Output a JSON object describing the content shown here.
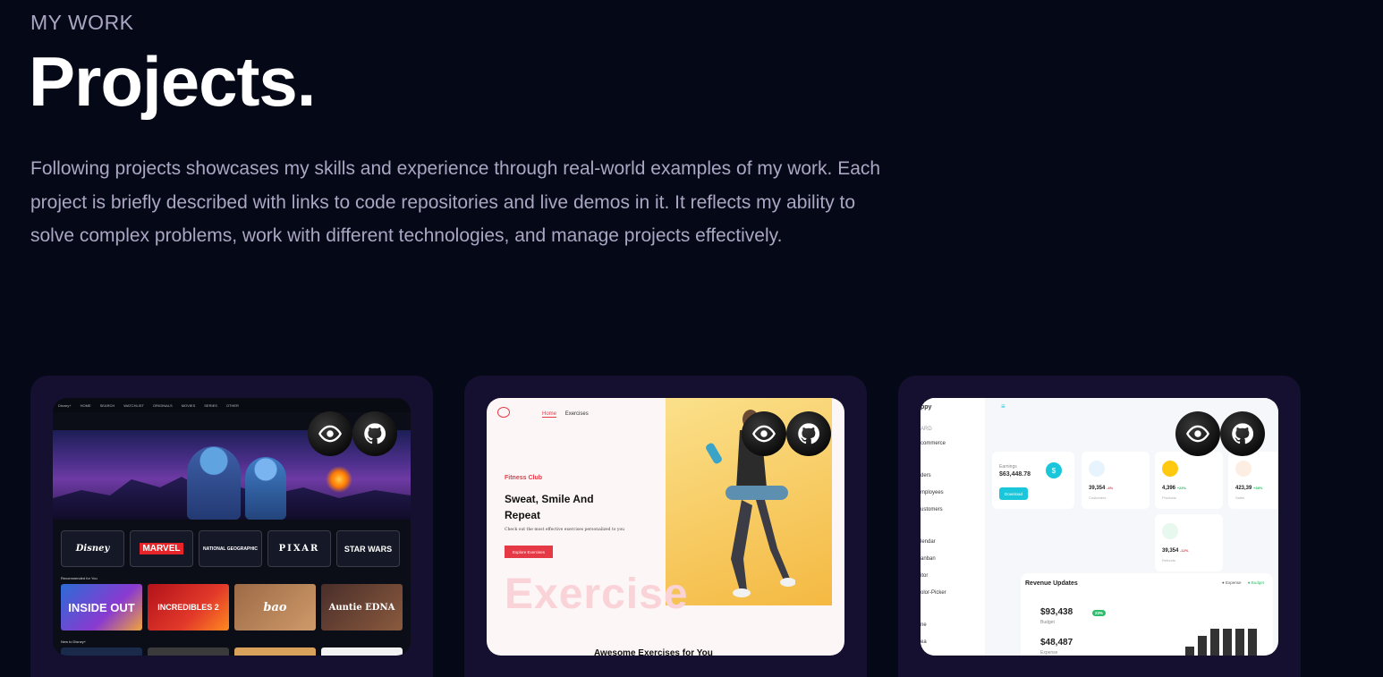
{
  "section": {
    "eyebrow": "MY WORK",
    "title": "Projects.",
    "description": "Following projects showcases my skills and experience through real-world examples of my work. Each project is briefly described with links to code repositories and live demos in it. It reflects my ability to solve complex problems, work with different technologies, and manage projects effectively."
  },
  "projects": [
    {
      "preview": {
        "nav": [
          "Disney+",
          "HOME",
          "SEARCH",
          "WATCHLIST",
          "ORIGINALS",
          "MOVIES",
          "SERIES",
          "OTHER"
        ],
        "brands": [
          "Disney",
          "MARVEL",
          "NATIONAL GEOGRAPHIC",
          "PIXAR",
          "STAR WARS"
        ],
        "recommended_label": "Recommended for You",
        "tiles": [
          "INSIDE OUT",
          "INCREDIBLES 2",
          "bao",
          "Auntie EDNA"
        ],
        "new_label": "New to Disney+"
      },
      "demo_icon": "eye-icon",
      "code_icon": "github-icon"
    },
    {
      "preview": {
        "nav": [
          "Home",
          "Exercises"
        ],
        "tag": "Fitness Club",
        "headline": "Sweat, Smile And Repeat",
        "sub": "Check out the most effective exercises personalized to you",
        "cta": "Explore Exercises",
        "watermark": "Exercise",
        "bottom": "Awesome Exercises for You"
      },
      "demo_icon": "eye-icon",
      "code_icon": "github-icon"
    },
    {
      "preview": {
        "brand": "ppy",
        "menu": [
          "ARD",
          "commerce",
          "ders",
          "mployees",
          "ustomers",
          "lendar",
          "anban",
          "itor",
          "olor-Picker",
          "ne",
          "ea"
        ],
        "earnings_label": "Earnings",
        "earnings_value": "$63,448.78",
        "download": "Download",
        "stats": [
          {
            "value": "39,354",
            "change": "-4%",
            "label": "Customers",
            "color": "#e8f4fd"
          },
          {
            "value": "4,396",
            "change": "+23%",
            "label": "Products",
            "color": "#fec90f"
          },
          {
            "value": "423,39",
            "change": "+38%",
            "label": "Sales",
            "color": "#fdeee3"
          },
          {
            "value": "39,354",
            "change": "-12%",
            "label": "Refunds",
            "color": "#e7f8ef"
          }
        ],
        "revenue_title": "Revenue Updates",
        "legend": [
          "Expense",
          "Budget"
        ],
        "budget_value": "$93,438",
        "budget_badge": "23%",
        "budget_label": "Budget",
        "expense_value": "$48,487",
        "expense_label": "Expense",
        "bar_values": [
          10,
          22,
          30,
          30,
          30,
          30
        ]
      },
      "demo_icon": "eye-icon",
      "code_icon": "github-icon"
    }
  ]
}
